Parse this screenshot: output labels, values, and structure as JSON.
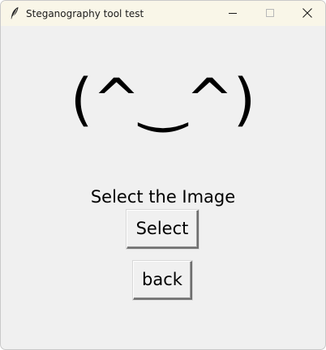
{
  "window": {
    "title": "Steganography tool test",
    "app_icon": "feather-icon",
    "controls": {
      "minimize_icon": "minimize-icon",
      "maximize_icon": "maximize-icon",
      "close_icon": "close-icon"
    }
  },
  "main": {
    "emoticon": "(^‿^)",
    "prompt_label": "Select the Image",
    "select_button_label": "Select",
    "back_button_label": "back"
  },
  "colors": {
    "titlebar": "#f9f6e8",
    "background": "#f0f0f0",
    "text": "#000000"
  }
}
